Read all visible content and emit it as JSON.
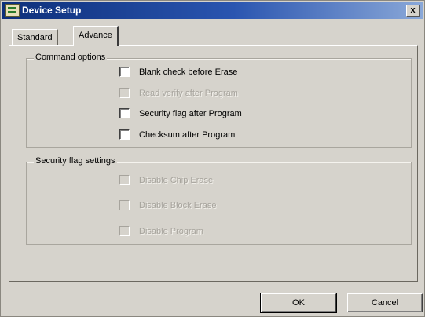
{
  "window": {
    "title": "Device Setup",
    "close_label": "x"
  },
  "tabs": [
    {
      "label": "Standard",
      "selected": false
    },
    {
      "label": "Advance",
      "selected": true
    }
  ],
  "command_options": {
    "label": "Command options",
    "items": [
      {
        "label": "Blank check before Erase",
        "checked": false,
        "enabled": true
      },
      {
        "label": "Read verify after Program",
        "checked": false,
        "enabled": false
      },
      {
        "label": "Security flag after Program",
        "checked": false,
        "enabled": true
      },
      {
        "label": "Checksum after Program",
        "checked": false,
        "enabled": true
      }
    ]
  },
  "security_flag_settings": {
    "label": "Security flag settings",
    "items": [
      {
        "label": "Disable Chip Erase",
        "checked": false,
        "enabled": false
      },
      {
        "label": "Disable Block Erase",
        "checked": false,
        "enabled": false
      },
      {
        "label": "Disable Program",
        "checked": false,
        "enabled": false
      }
    ]
  },
  "buttons": {
    "ok": "OK",
    "cancel": "Cancel"
  }
}
